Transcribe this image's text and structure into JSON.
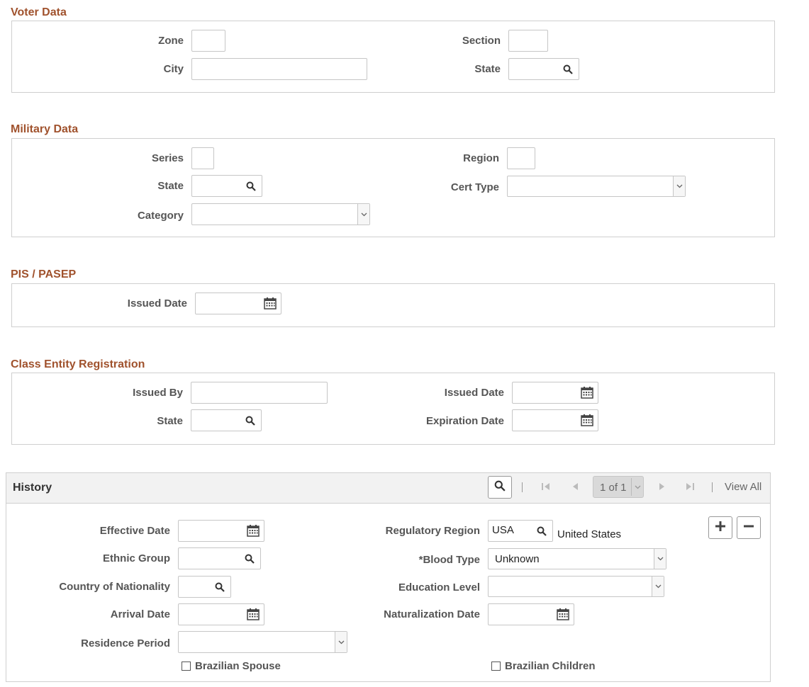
{
  "voter": {
    "title": "Voter Data",
    "zone_label": "Zone",
    "section_label": "Section",
    "city_label": "City",
    "state_label": "State"
  },
  "military": {
    "title": "Military Data",
    "series_label": "Series",
    "region_label": "Region",
    "state_label": "State",
    "cert_type_label": "Cert Type",
    "category_label": "Category"
  },
  "pis": {
    "title": "PIS / PASEP",
    "issued_date_label": "Issued Date"
  },
  "class_entity": {
    "title": "Class Entity Registration",
    "issued_by_label": "Issued By",
    "issued_date_label": "Issued Date",
    "state_label": "State",
    "expiration_date_label": "Expiration Date"
  },
  "history": {
    "title": "History",
    "pager": "1 of 1",
    "view_all": "View All",
    "effective_date_label": "Effective Date",
    "regulatory_region_label": "Regulatory Region",
    "regulatory_region_value": "USA",
    "regulatory_region_desc": "United States",
    "ethnic_group_label": "Ethnic Group",
    "blood_type_label": "*Blood Type",
    "blood_type_value": "Unknown",
    "country_label": "Country of Nationality",
    "education_label": "Education Level",
    "arrival_date_label": "Arrival Date",
    "naturalization_label": "Naturalization Date",
    "residence_label": "Residence Period",
    "brazilian_spouse_label": "Brazilian Spouse",
    "brazilian_children_label": "Brazilian Children"
  },
  "icons": {
    "search": "search-icon",
    "calendar": "calendar-icon",
    "dropdown": "chevron-down-icon",
    "add": "plus-icon",
    "remove": "minus-icon"
  },
  "colors": {
    "section_title": "#a0522d",
    "label": "#555555",
    "border": "#cfcfcf"
  }
}
